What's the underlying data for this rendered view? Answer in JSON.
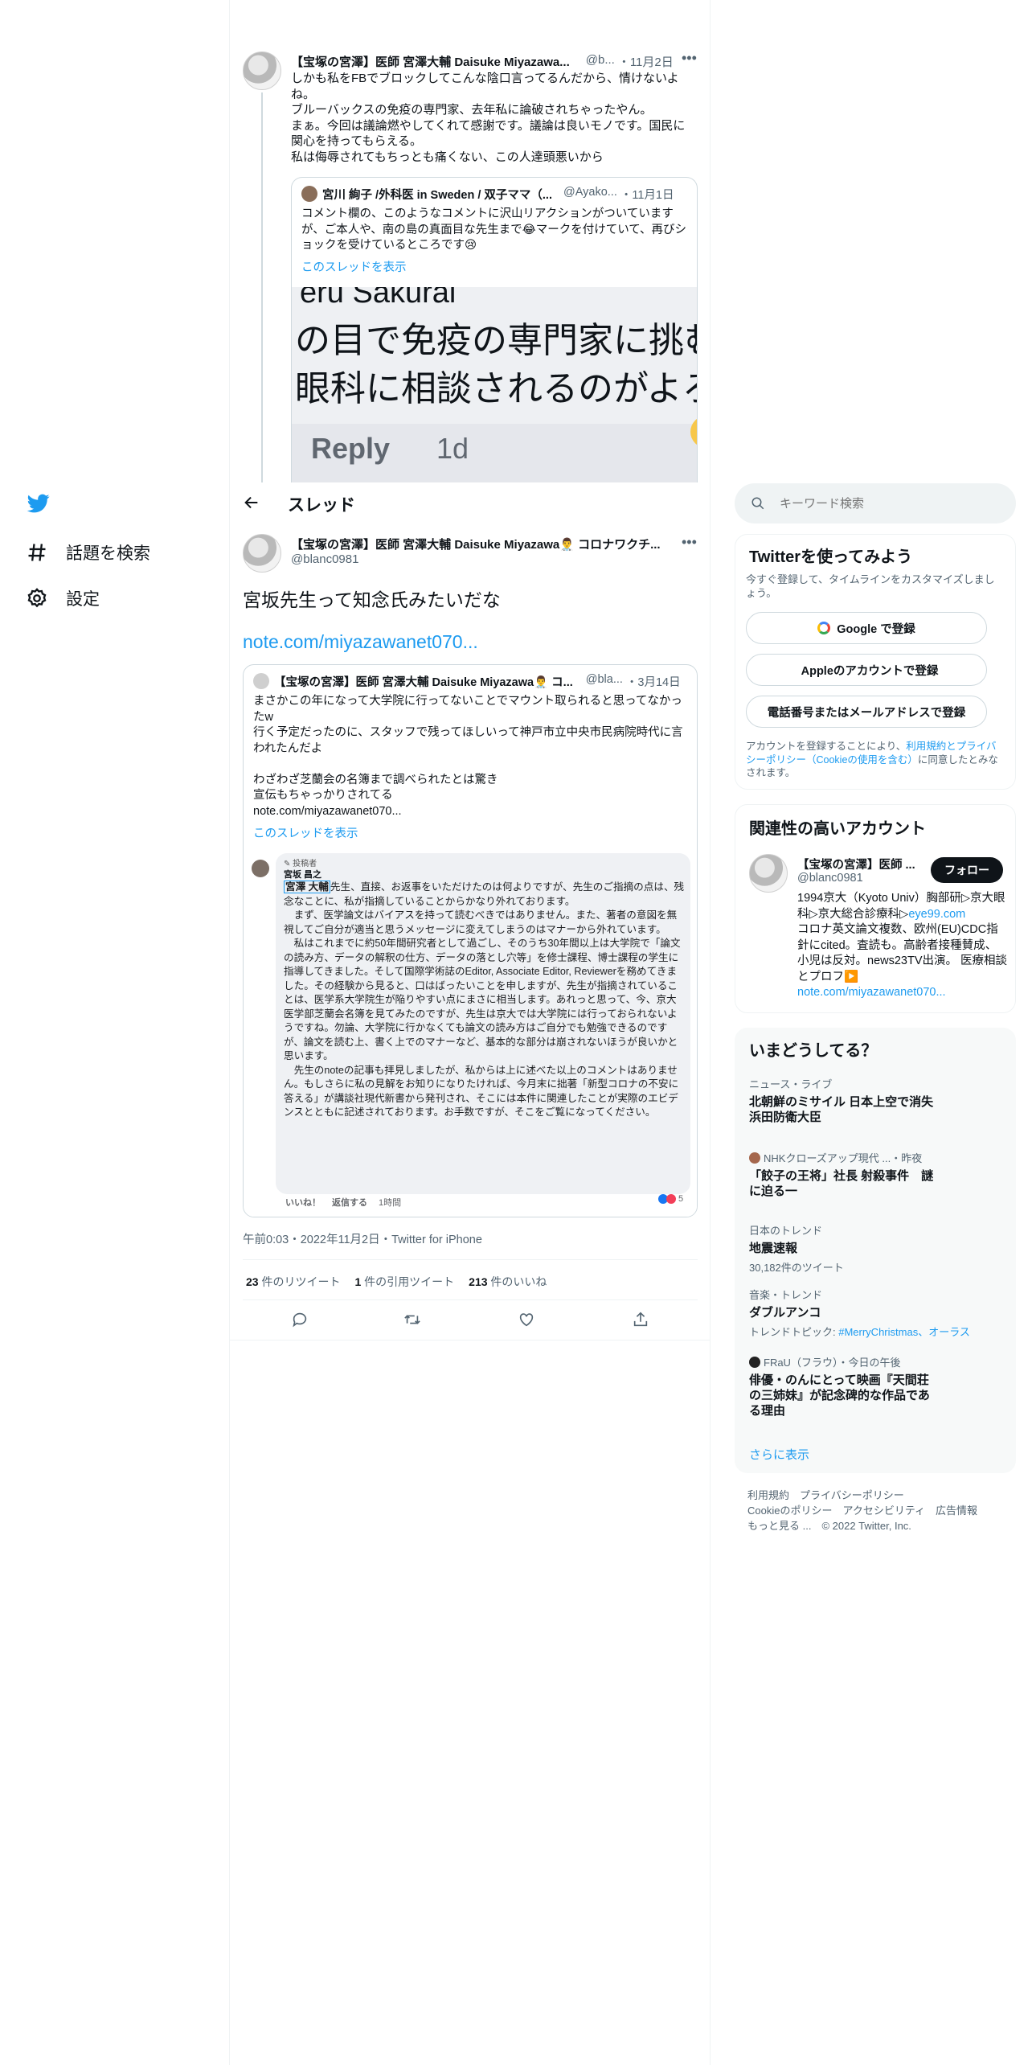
{
  "colors": {
    "accent": "#1d9bf0",
    "border": "#eff3f4",
    "text": "#0f1419",
    "muted": "#536471"
  },
  "nav": {
    "logo_icon": "twitter-bird-icon",
    "explore_label": "話題を検索",
    "settings_label": "設定"
  },
  "header": {
    "title": "スレッド"
  },
  "search": {
    "placeholder": "キーワード検索"
  },
  "top_tweet": {
    "name": "【宝塚の宮澤】医師 宮澤大輔 Daisuke Miyazawa...",
    "handle": "@b...",
    "date": "・11月2日",
    "text": "しかも私をFBでブロックしてこんな陰口言ってるんだから、情けないよね。\nブルーバックスの免疫の専門家、去年私に論破されちゃったやん。\nまぁ。今回は議論燃やしてくれて感謝です。議論は良いモノです。国民に関心を持ってもらえる。\n私は侮辱されてもちっとも痛くない、この人達頭悪いから",
    "quote": {
      "name": "宮川 絢子 /外科医 in Sweden / 双子ママ（...",
      "handle": "@Ayako...",
      "date": "・11月1日",
      "text": "コメント欄の、このようなコメントに沢山リアクションがついていますが、ご本人や、南の島の真面目な先生まで😂マークを付けていて、再びショックを受けているところです😢",
      "show_thread": "このスレッドを表示",
      "image_line1": "eru Sakurai",
      "image_line2": "の目で免疫の専門家に挑む",
      "image_line3": "眼科に相談されるのがよろ",
      "image_reply": "Reply",
      "image_time": "1d"
    }
  },
  "main_tweet": {
    "name": "【宝塚の宮澤】医師 宮澤大輔 Daisuke Miyazawa👨‍⚕️ コロナワクチ...",
    "handle": "@blanc0981",
    "text": "宮坂先生って知念氏みたいだな",
    "link": "note.com/miyazawanet070...",
    "quote": {
      "name": "【宝塚の宮澤】医師 宮澤大輔 Daisuke Miyazawa👨‍⚕️ コ...",
      "handle": "@bla...",
      "date": "・3月14日",
      "text": "まさかこの年になって大学院に行ってないことでマウント取られると思ってなかったw\n行く予定だったのに、スタッフで残ってほしいって神戸市立中央市民病院時代に言われたんだよ\n\nわざわざ芝蘭会の名簿まで調べられたとは驚き\n宣伝もちゃっかりされてる\nnote.com/miyazawanet070...",
      "show_thread": "このスレッドを表示",
      "fb_author_badge": "投稿者",
      "fb_author": "宮坂 昌之",
      "fb_mention": "宮澤 大輔",
      "fb_text": "先生、直接、お返事をいただけたのは何よりですが、先生のご指摘の点は、残念なことに、私が指摘していることからかなり外れております。\n　まず、医学論文はバイアスを持って読むべきではありません。また、著者の意図を無視してご自分が適当と思うメッセージに変えてしまうのはマナーから外れています。\n　私はこれまでに約50年間研究者として過ごし、そのうち30年間以上は大学院で「論文の読み方、データの解釈の仕方、データの落とし穴等」を修士課程、博士課程の学生に指導してきました。そして国際学術誌のEditor, Associate Editor, Reviewerを務めてきました。その経験から見ると、口はばったいことを申しますが、先生が指摘されていることは、医学系大学院生が陥りやすい点にまさに相当します。あれっと思って、今、京大医学部芝蘭会名簿を見てみたのですが、先生は京大では大学院には行っておられないようですね。勿論、大学院に行かなくても論文の読み方はご自分でも勉強できるのですが、論文を読む上、書く上でのマナーなど、基本的な部分は崩されないほうが良いかと思います。\n　先生のnoteの記事も拝見しましたが、私からは上に述べた以上のコメントはありません。もしさらに私の見解をお知りになりたければ、今月末に拙著「新型コロナの不安に答える」が講談社現代新書から発刊され、そこには本件に関連したことが実際のエビデンスとともに記述されております。お手数ですが、そこをご覧になってください。",
      "fb_like": "いいね！",
      "fb_reply": "返信する",
      "fb_time": "1時間",
      "fb_reaction_count": "5"
    },
    "timestamp": "午前0:03・2022年11月2日・Twitter for iPhone",
    "stats": {
      "retweets_num": "23",
      "retweets_label": "件のリツイート",
      "quotes_num": "1",
      "quotes_label": "件の引用ツイート",
      "likes_num": "213",
      "likes_label": "件のいいね"
    }
  },
  "signup": {
    "title": "Twitterを使ってみよう",
    "subtitle": "今すぐ登録して、タイムラインをカスタマイズしましょう。",
    "google": "Google で登録",
    "apple": "Appleのアカウントで登録",
    "phone": "電話番号またはメールアドレスで登録",
    "legal_pre": "アカウントを登録することにより、",
    "legal_terms": "利用規約とプライバシーポリシー（Cookieの使用を含む）",
    "legal_post": "に同意したとみなされます。"
  },
  "related": {
    "title": "関連性の高いアカウント",
    "name": "【宝塚の宮澤】医師 ...",
    "handle": "@blanc0981",
    "follow": "フォロー",
    "bio": "1994京大（Kyoto Univ）胸部研▷京大眼科▷京大総合診療科▷",
    "bio_link": "eye99.com",
    "bio2": "コロナ英文論文複数、欧州(EU)CDC指針にcited。査読も。高齢者接種賛成、小児は反対。news23TV出演。 医療相談とプロフ▶️",
    "bio_link2": "note.com/miyazawanet070..."
  },
  "trends": {
    "title": "いまどうしてる？",
    "items": [
      {
        "category": "ニュース・ライブ",
        "title": "北朝鮮のミサイル 日本上空で消失\n浜田防衛大臣"
      },
      {
        "category": "NHKクローズアップ現代 ...・昨夜",
        "title": "「餃子の王将」社長 射殺事件　謎\nに迫る一"
      },
      {
        "category": "日本のトレンド",
        "title": "地震速報",
        "meta": "30,182件のツイート"
      },
      {
        "category": "音楽・トレンド",
        "title": "ダブルアンコ",
        "meta_pre": "トレンドトピック: ",
        "meta_link": "#MerryChristmas、オーラス"
      },
      {
        "category": "FRaU（フラウ）・今日の午後",
        "title": "俳優・のんにとって映画『天間荘\nの三姉妹』が記念碑的な作品であ\nる理由"
      }
    ],
    "more": "さらに表示"
  },
  "footer": {
    "line1": "利用規約　プライバシーポリシー",
    "line2": "Cookieのポリシー　アクセシビリティ　広告情報",
    "line3": "もっと見る ...　© 2022 Twitter, Inc."
  }
}
